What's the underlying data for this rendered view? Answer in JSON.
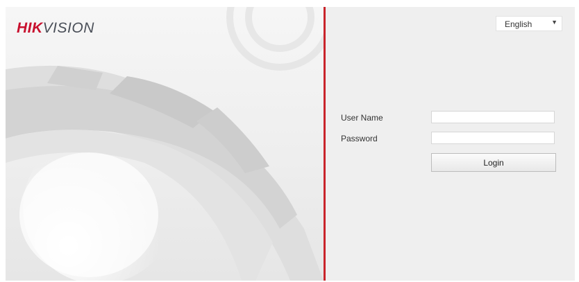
{
  "brand": {
    "logo_part1": "HIK",
    "logo_part2": "VISION",
    "accent_color": "#c9242b",
    "logo_red": "#c8102e"
  },
  "language": {
    "selected": "English",
    "icon": "chevron-down-icon"
  },
  "login_form": {
    "username_label": "User Name",
    "username_value": "",
    "password_label": "Password",
    "password_value": "",
    "login_button_label": "Login"
  }
}
